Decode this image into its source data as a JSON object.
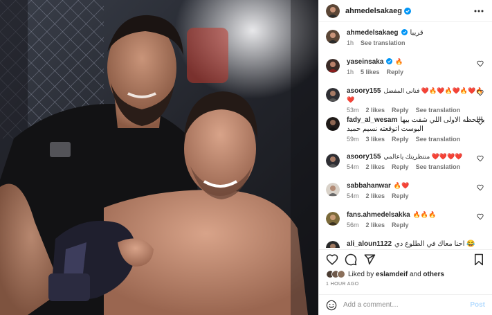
{
  "media": {
    "description_icon": "photo"
  },
  "post": {
    "author": "ahmedelsakaeg",
    "more_icon": "ellipsis-icon"
  },
  "caption": {
    "username": "ahmedelsakaeg",
    "text": "قريبا",
    "time": "1h",
    "see_translation": "See translation"
  },
  "comments": [
    {
      "username": "yaseinsaka",
      "verified": true,
      "text": "🔥",
      "time": "1h",
      "likes": "5 likes",
      "reply": "Reply",
      "translation": ""
    },
    {
      "username": "asoory155",
      "verified": false,
      "text": "فناني المفضل ❤️🔥❤️🔥❤️🔥❤️🔥❤️",
      "time": "53m",
      "likes": "2 likes",
      "reply": "Reply",
      "translation": "See translation"
    },
    {
      "username": "fady_al_wesam",
      "verified": false,
      "text": "باللحظه الاولى اللي شفت بيها البوست اتوقعته نسيم حميد",
      "time": "59m",
      "likes": "3 likes",
      "reply": "Reply",
      "translation": "See translation"
    },
    {
      "username": "asoory155",
      "verified": false,
      "text": "منتظريتك ياعالمي ❤️❤️❤️❤️",
      "time": "54m",
      "likes": "2 likes",
      "reply": "Reply",
      "translation": "See translation"
    },
    {
      "username": "sabbahanwar",
      "verified": false,
      "text": "🔥❤️",
      "time": "54m",
      "likes": "2 likes",
      "reply": "Reply",
      "translation": ""
    },
    {
      "username": "fans.ahmedelsakka",
      "verified": false,
      "text": "🔥🔥🔥",
      "time": "56m",
      "likes": "2 likes",
      "reply": "Reply",
      "translation": ""
    },
    {
      "username": "ali_aloun1122",
      "verified": false,
      "text": "😂 احنا معاك في الطلوع دي",
      "time": "",
      "likes": "",
      "reply": "",
      "translation": ""
    }
  ],
  "likes_summary": {
    "prefix": "Liked by",
    "user": "eslamdeif",
    "middle": "and",
    "others": "others"
  },
  "timestamp": "1 HOUR AGO",
  "add_comment": {
    "placeholder": "Add a comment…",
    "post_label": "Post"
  },
  "colors": {
    "accent": "#0095f6",
    "verified": "#0095f6",
    "muted": "#737373",
    "post_disabled": "#b3dbff"
  }
}
